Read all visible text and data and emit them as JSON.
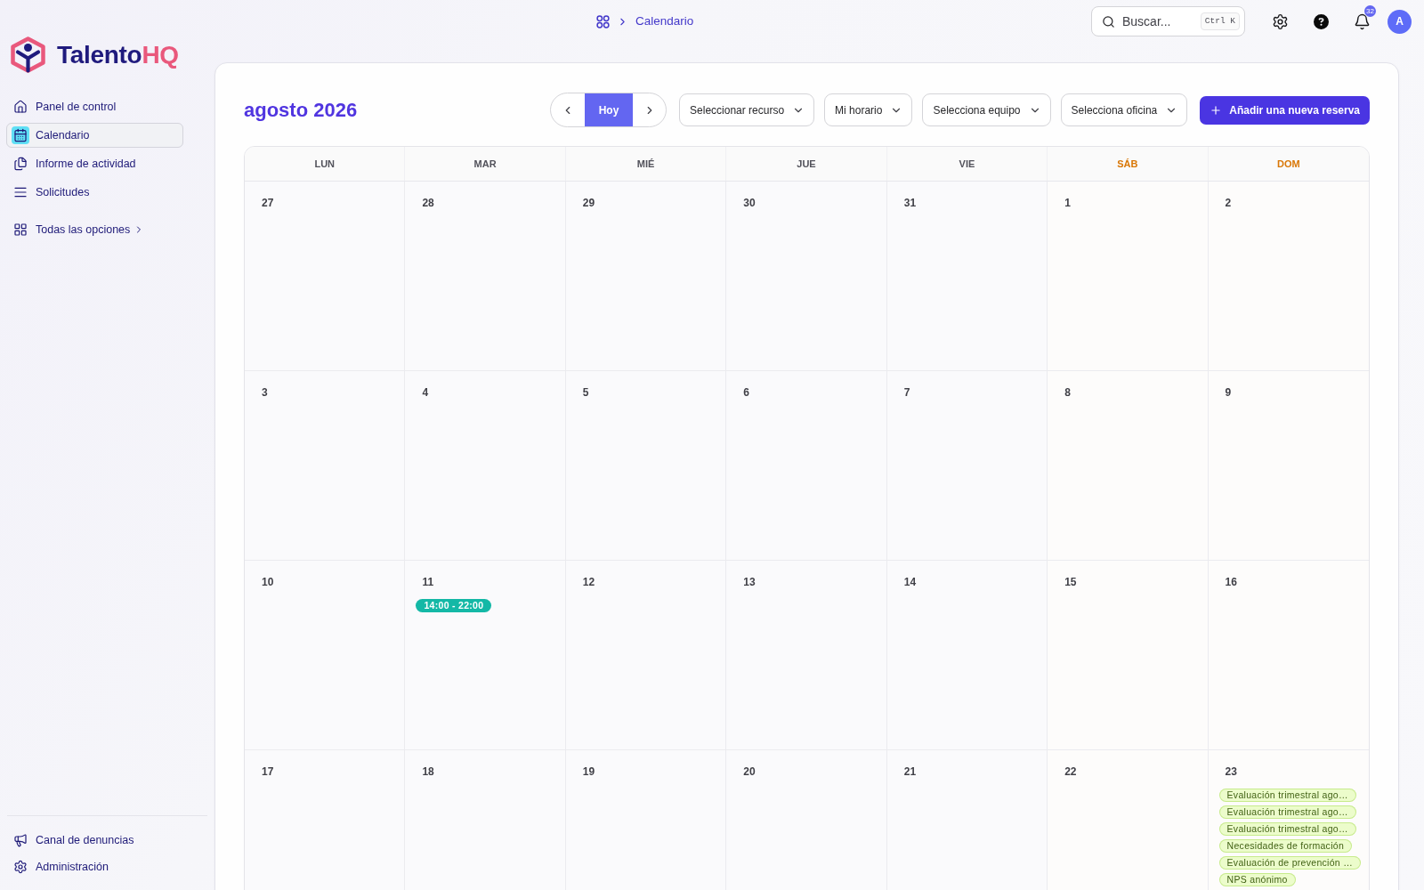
{
  "sidebar": {
    "brand": {
      "name": "Talento",
      "accent": "HQ"
    },
    "items": [
      {
        "label": "Panel de control",
        "selected": false
      },
      {
        "label": "Calendario",
        "selected": true
      },
      {
        "label": "Informe de actividad",
        "selected": false
      },
      {
        "label": "Solicitudes",
        "selected": false
      }
    ],
    "more": {
      "label": "Todas las opciones"
    },
    "footer_items": [
      {
        "label": "Canal de denuncias"
      },
      {
        "label": "Administración"
      }
    ]
  },
  "topbar": {
    "breadcrumb": {
      "current": "Calendario"
    },
    "search": {
      "placeholder": "Buscar...",
      "shortcut": "Ctrl K"
    },
    "notifications": "32",
    "avatar": "A"
  },
  "calendar": {
    "title": "agosto 2026",
    "today_button": "Hoy",
    "filters": [
      "Seleccionar recurso",
      "Mi horario",
      "Selecciona equipo",
      "Selecciona oficina"
    ],
    "add_button": "Añadir una nueva reserva",
    "weekdays": [
      {
        "label": "LUN",
        "weekend": false
      },
      {
        "label": "MAR",
        "weekend": false
      },
      {
        "label": "MIÉ",
        "weekend": false
      },
      {
        "label": "JUE",
        "weekend": false
      },
      {
        "label": "VIE",
        "weekend": false
      },
      {
        "label": "SÁB",
        "weekend": true
      },
      {
        "label": "DOM",
        "weekend": true
      }
    ],
    "weeks": [
      [
        {
          "day": "27"
        },
        {
          "day": "28"
        },
        {
          "day": "29"
        },
        {
          "day": "30"
        },
        {
          "day": "31"
        },
        {
          "day": "1"
        },
        {
          "day": "2"
        }
      ],
      [
        {
          "day": "3"
        },
        {
          "day": "4"
        },
        {
          "day": "5"
        },
        {
          "day": "6"
        },
        {
          "day": "7"
        },
        {
          "day": "8"
        },
        {
          "day": "9"
        }
      ],
      [
        {
          "day": "10"
        },
        {
          "day": "11",
          "events": [
            {
              "label": "14:00 - 22:00",
              "color": "#14b8a6"
            }
          ]
        },
        {
          "day": "12"
        },
        {
          "day": "13"
        },
        {
          "day": "14"
        },
        {
          "day": "15"
        },
        {
          "day": "16"
        }
      ],
      [
        {
          "day": "17"
        },
        {
          "day": "18"
        },
        {
          "day": "19"
        },
        {
          "day": "20"
        },
        {
          "day": "21"
        },
        {
          "day": "22"
        },
        {
          "day": "23",
          "events": [
            {
              "label": "Evaluación trimestral ago…",
              "color": "#ecfccb"
            },
            {
              "label": "Evaluación trimestral ago…",
              "color": "#ecfccb"
            },
            {
              "label": "Evaluación trimestral ago…",
              "color": "#ecfccb"
            },
            {
              "label": "Necesidades de formación",
              "color": "#ecfccb"
            },
            {
              "label": "Evaluación de prevención …",
              "color": "#ecfccb"
            },
            {
              "label": "NPS anónimo",
              "color": "#ecfccb"
            }
          ]
        }
      ]
    ]
  }
}
